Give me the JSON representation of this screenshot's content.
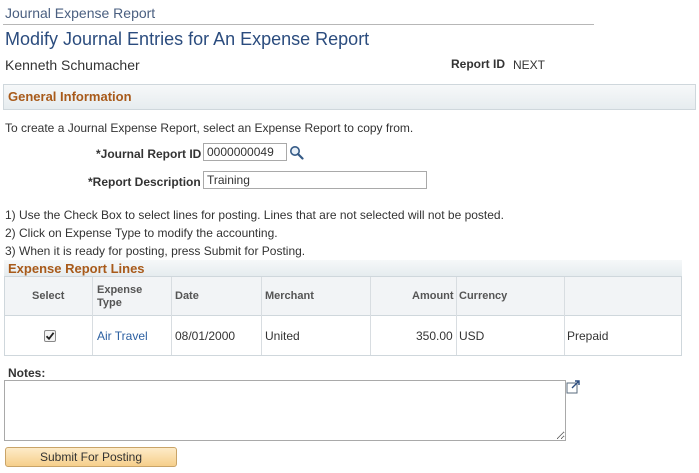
{
  "app": {
    "title": "Journal Expense Report"
  },
  "page": {
    "title": "Modify Journal Entries for An Expense Report",
    "employee_name": "Kenneth Schumacher",
    "report_id_label": "Report ID",
    "report_id_value": "NEXT"
  },
  "general_info": {
    "header": "General Information",
    "intro": "To create a Journal Expense Report, select an Expense Report to copy from.",
    "journal_report_id_label": "*Journal Report ID",
    "journal_report_id_value": "0000000049",
    "report_description_label": "*Report Description",
    "report_description_value": "Training"
  },
  "instructions": [
    "1) Use the Check Box to select lines for posting. Lines that are not selected will not be posted.",
    "2) Click on Expense Type to modify the accounting.",
    "3) When it is ready for posting, press Submit for Posting."
  ],
  "expense_lines": {
    "title": "Expense Report Lines",
    "columns": {
      "select": "Select",
      "expense_type_1": "Expense",
      "expense_type_2": "Type",
      "date": "Date",
      "merchant": "Merchant",
      "amount": "Amount",
      "currency": "Currency"
    },
    "rows": [
      {
        "selected": true,
        "expense_type": "Air Travel",
        "date": "08/01/2000",
        "merchant": "United",
        "amount": "350.00",
        "currency": "USD",
        "payment": "Prepaid"
      }
    ]
  },
  "notes": {
    "label": "Notes:",
    "value": ""
  },
  "actions": {
    "submit_label": "Submit For Posting"
  },
  "icons": {
    "lookup": "magnifier-icon",
    "expand": "expand-icon"
  },
  "colors": {
    "section_title": "#a85a1a",
    "page_title": "#2b4c7e",
    "link": "#2b5fa1",
    "button": "#f6cf8b"
  }
}
